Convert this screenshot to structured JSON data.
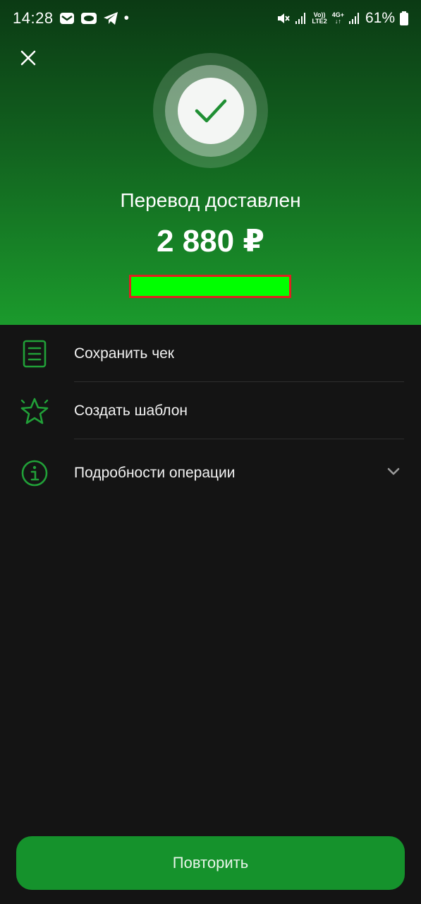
{
  "status_bar": {
    "time": "14:28",
    "dot": "•",
    "volte_top": "Vo))",
    "volte_bottom": "LTE2",
    "network_top": "4G+",
    "network_bottom": "↓↑",
    "battery": "61%",
    "left_icons": [
      "mail-icon",
      "chat-bubble-icon",
      "telegram-icon"
    ],
    "right_icons": [
      "mute-icon",
      "signal-icon",
      "signal-icon",
      "battery-icon"
    ]
  },
  "header": {
    "close_icon": "close-icon"
  },
  "result": {
    "status_icon": "checkmark-icon",
    "title": "Перевод доставлен",
    "amount": "2 880 ₽"
  },
  "actions": [
    {
      "label": "Сохранить чек",
      "icon": "receipt-icon"
    },
    {
      "label": "Создать шаблон",
      "icon": "star-icon"
    },
    {
      "label": "Подробности операции",
      "icon": "info-icon",
      "trailing_icon": "chevron-down-icon"
    }
  ],
  "footer": {
    "repeat_label": "Повторить"
  },
  "colors": {
    "accent_green": "#15922c",
    "icon_green": "#21a038",
    "background": "#141414",
    "mask_fill": "#00ff00",
    "mask_border": "#e02020"
  }
}
